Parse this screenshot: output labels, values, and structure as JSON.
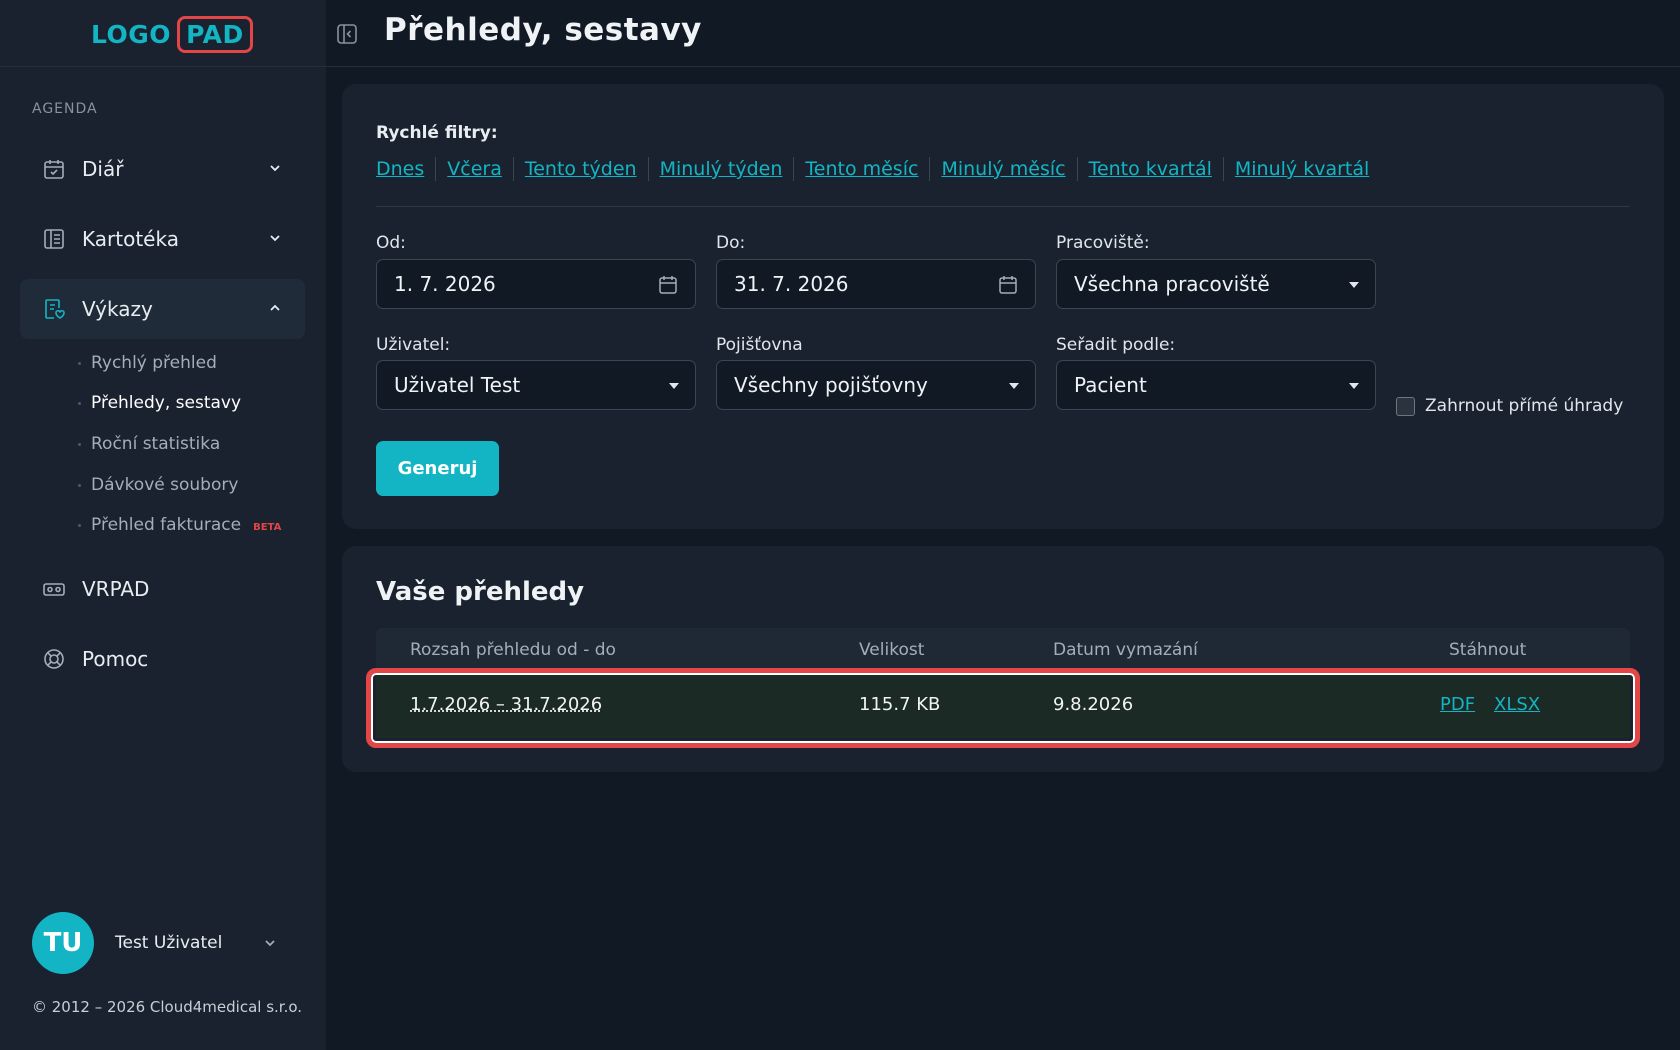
{
  "app": {
    "logo_part1": "LOGO",
    "logo_part2": "PAD"
  },
  "sidebar": {
    "section_label": "AGENDA",
    "items": [
      {
        "label": "Diář",
        "icon": "calendar-check-icon",
        "expanded": false
      },
      {
        "label": "Kartotéka",
        "icon": "address-book-icon",
        "expanded": false
      },
      {
        "label": "Výkazy",
        "icon": "report-icon",
        "expanded": true
      },
      {
        "label": "VRPAD",
        "icon": "vr-headset-icon"
      },
      {
        "label": "Pomoc",
        "icon": "lifebuoy-icon"
      }
    ],
    "sub_items": [
      {
        "label": "Rychlý přehled"
      },
      {
        "label": "Přehledy, sestavy",
        "current": true
      },
      {
        "label": "Roční statistika"
      },
      {
        "label": "Dávkové soubory"
      },
      {
        "label": "Přehled fakturace",
        "badge": "BETA"
      }
    ]
  },
  "user": {
    "initials": "TU",
    "name": "Test Uživatel"
  },
  "footer": {
    "copyright": "© 2012 – 2026 Cloud4medical s.r.o."
  },
  "header": {
    "title": "Přehledy, sestavy"
  },
  "filters": {
    "title": "Rychlé filtry:",
    "quick": [
      "Dnes",
      "Včera",
      "Tento týden",
      "Minulý týden",
      "Tento měsíc",
      "Minulý měsíc",
      "Tento kvartál",
      "Minulý kvartál"
    ],
    "from_label": "Od:",
    "from_value": "1. 7. 2026",
    "to_label": "Do:",
    "to_value": "31. 7. 2026",
    "workplace_label": "Pracoviště:",
    "workplace_value": "Všechna pracoviště",
    "user_label": "Uživatel:",
    "user_value": "Uživatel Test",
    "insurer_label": "Pojišťovna",
    "insurer_value": "Všechny pojišťovny",
    "sort_label": "Seřadit podle:",
    "sort_value": "Pacient",
    "include_direct_label": "Zahrnout přímé úhrady",
    "include_direct_checked": false,
    "generate_label": "Generuj"
  },
  "reports": {
    "title": "Vaše přehledy",
    "columns": [
      "Rozsah přehledu od - do",
      "Velikost",
      "Datum vymazání",
      "Stáhnout"
    ],
    "rows": [
      {
        "range": "1.7.2026 – 31.7.2026",
        "size": "115.7 KB",
        "delete_date": "9.8.2026",
        "pdf": "PDF",
        "xlsx": "XLSX"
      }
    ]
  },
  "colors": {
    "accent": "#13b5c4",
    "highlight": "#e24646",
    "background": "#111924",
    "panel": "#19222e"
  }
}
